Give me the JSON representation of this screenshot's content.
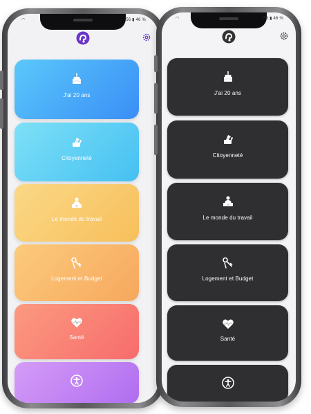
{
  "status_bar": {
    "time": "",
    "indicators": "56 ▮ 46 %"
  },
  "phones": [
    {
      "theme": "light",
      "logo_color": "#6a35c8",
      "settings_icon": "gear-icon"
    },
    {
      "theme": "dark",
      "logo_color": "#333333",
      "settings_icon": "gear-icon"
    }
  ],
  "categories": [
    {
      "label": "J'ai 20 ans",
      "icon": "birthday-cake-icon",
      "gradient": [
        "#5ac8fa",
        "#3a8ef6"
      ]
    },
    {
      "label": "Citoyenneté",
      "icon": "ballot-vote-icon",
      "gradient": [
        "#7ee0f7",
        "#45c0f2"
      ]
    },
    {
      "label": "Le monde du travail",
      "icon": "worker-desk-icon",
      "gradient": [
        "#fbd886",
        "#f7bf5b"
      ]
    },
    {
      "label": "Logement et Budget",
      "icon": "keys-icon",
      "gradient": [
        "#fcca7c",
        "#f6a85e"
      ]
    },
    {
      "label": "Santé",
      "icon": "heartbeat-icon",
      "gradient": [
        "#fb9a80",
        "#f76c6c"
      ]
    },
    {
      "label": "",
      "icon": "accessibility-icon",
      "gradient": [
        "#d59cf7",
        "#b06df0"
      ]
    }
  ]
}
